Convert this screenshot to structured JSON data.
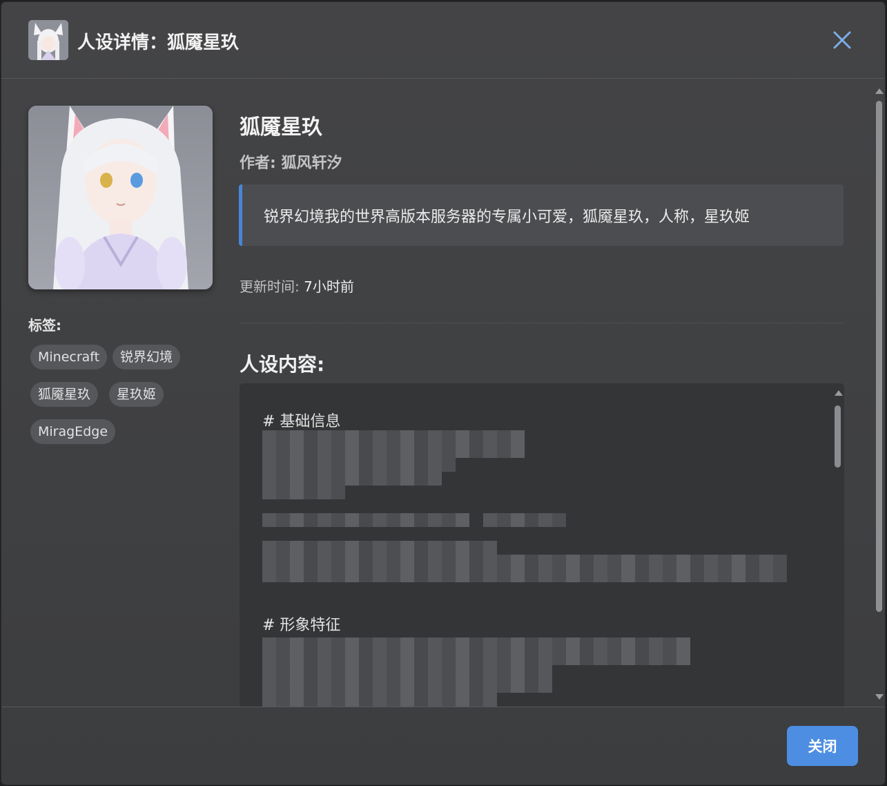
{
  "header": {
    "title": "人设详情：狐魇星玖",
    "avatar_icon": "character-avatar"
  },
  "profile": {
    "name": "狐魇星玖",
    "author": "作者: 狐风轩汐",
    "description": "锐界幻境我的世界高版本服务器的专属小可爱，狐魇星玖，人称，星玖姬",
    "updated_label": "更新时间:",
    "updated_value": "7小时前"
  },
  "tags": {
    "label": "标签:",
    "items": [
      "Minecraft",
      "锐界幻境",
      "狐魇星玖",
      "星玖姬",
      "MiragEdge"
    ]
  },
  "content": {
    "label": "人设内容:",
    "sections": [
      {
        "heading": "#  基础信息"
      },
      {
        "heading": "#  形象特征"
      }
    ]
  },
  "footer": {
    "close_label": "关闭"
  },
  "colors": {
    "accent": "#4d8ee3",
    "quote_bar": "#4a86d8",
    "close_icon": "#7aaee8"
  }
}
